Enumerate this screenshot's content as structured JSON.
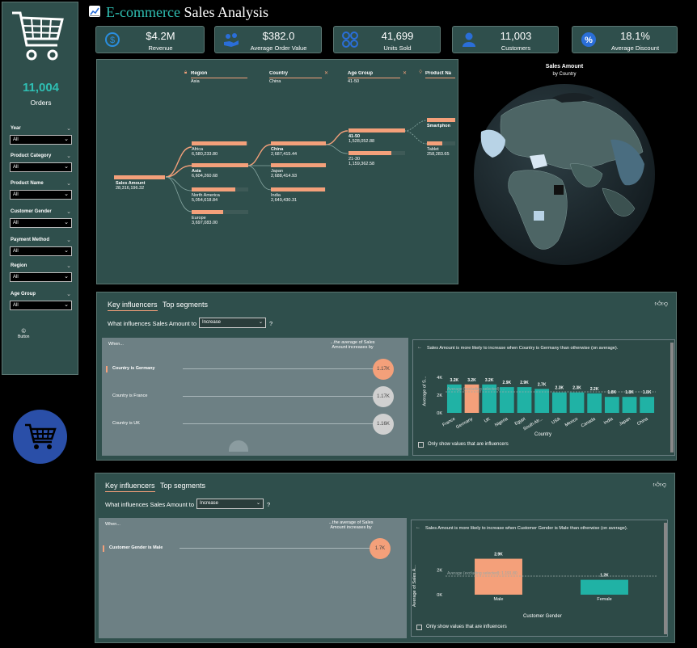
{
  "title": {
    "icon": "chart-increasing-icon",
    "prefix": "E-commerce",
    "rest": "Sales Analysis"
  },
  "sidebar": {
    "orders_value": "11,004",
    "orders_label": "Orders",
    "filters": [
      {
        "label": "Year",
        "value": "All"
      },
      {
        "label": "Product Category",
        "value": "All"
      },
      {
        "label": "Product Name",
        "value": "All"
      },
      {
        "label": "Customer Gender",
        "value": "All"
      },
      {
        "label": "Payment Method",
        "value": "All"
      },
      {
        "label": "Region",
        "value": "All"
      },
      {
        "label": "Age Group",
        "value": "All"
      }
    ],
    "button_label": "Button"
  },
  "kpis": [
    {
      "value": "$4.2M",
      "label": "Revenue",
      "icon": "dollar-icon"
    },
    {
      "value": "$382.0",
      "label": "Average Order Value",
      "icon": "hand-money-icon"
    },
    {
      "value": "41,699",
      "label": "Units Sold",
      "icon": "boxes-icon"
    },
    {
      "value": "11,003",
      "label": "Customers",
      "icon": "person-icon"
    },
    {
      "value": "18.1%",
      "label": "Average Discount",
      "icon": "percent-icon"
    }
  ],
  "decomp": {
    "headers": [
      {
        "title": "Region",
        "sub": "Asia",
        "icon": "lock-icon"
      },
      {
        "title": "Country",
        "sub": "China",
        "icon": "close-icon"
      },
      {
        "title": "Age Group",
        "sub": "41-50",
        "icon": "close-icon"
      },
      {
        "title": "Product Na",
        "sub": "",
        "icon": "bulb-icon"
      }
    ],
    "root": {
      "name": "Sales Amount",
      "value": "28,316,196.32"
    },
    "regions": [
      {
        "name": "Africa",
        "value": "6,580,233.80",
        "fill": 0.97
      },
      {
        "name": "Asia",
        "value": "6,604,260.68",
        "fill": 1.0
      },
      {
        "name": "North America",
        "value": "5,054,618.84",
        "fill": 0.77
      },
      {
        "name": "Europe",
        "value": "3,697,083.00",
        "fill": 0.56
      }
    ],
    "countries": [
      {
        "name": "China",
        "value": "2,687,415.44",
        "fill": 1.0
      },
      {
        "name": "Japan",
        "value": "2,688,414.93",
        "fill": 1.0
      },
      {
        "name": "India",
        "value": "2,649,430.31",
        "fill": 0.99
      }
    ],
    "ages": [
      {
        "name": "41-50",
        "value": "1,528,052.88",
        "fill": 1.0
      },
      {
        "name": "21-30",
        "value": "1,159,362.58",
        "fill": 0.76
      }
    ],
    "products": [
      {
        "name": "Smartphon",
        "value": "",
        "fill": 1.0
      },
      {
        "name": "Tablet",
        "value": "258,283.65",
        "fill": 0.55
      }
    ]
  },
  "map": {
    "title": "Sales Amount",
    "subtitle": "by Country"
  },
  "ki1": {
    "tab1": "Key influencers",
    "tab2": "Top segments",
    "question": "What influences Sales Amount to",
    "dropdown": "Increase",
    "q_mark": "?",
    "when": "When...",
    "avg_header": "...the average of Sales Amount increases by",
    "rows": [
      {
        "label": "Country is Germany",
        "value": "1.17K",
        "highlight": true
      },
      {
        "label": "Country is France",
        "value": "1.17K",
        "highlight": false
      },
      {
        "label": "Country is UK",
        "value": "1.16K",
        "highlight": false
      }
    ],
    "right_title": "Sales Amount is more likely to increase when Country is Germany than otherwise (on average).",
    "ylabel": "Average of S...",
    "xlabel": "Country",
    "checkbox": "Only show values that are influencers",
    "avg_line": "Average (excluding selected): ...",
    "chart_data": {
      "type": "bar",
      "ylim": [
        0,
        4000
      ],
      "yticks": [
        "4K",
        "2K",
        "0K"
      ],
      "categories": [
        "France",
        "Germany",
        "UK",
        "Nigeria",
        "Egypt",
        "South Afr...",
        "USA",
        "Mexico",
        "Canada",
        "India",
        "Japan",
        "China"
      ],
      "values": [
        3200,
        3200,
        3200,
        2900,
        2900,
        2700,
        2300,
        2300,
        2200,
        1800,
        1800,
        1800
      ],
      "labels": [
        "3.2K",
        "3.2K",
        "3.2K",
        "2.9K",
        "2.9K",
        "2.7K",
        "2.3K",
        "2.3K",
        "2.2K",
        "1.8K",
        "1.8K",
        "1.8K"
      ],
      "highlight": "Germany"
    }
  },
  "ki2": {
    "tab1": "Key influencers",
    "tab2": "Top segments",
    "question": "What influences Sales Amount to",
    "dropdown": "Increase",
    "q_mark": "?",
    "when": "When...",
    "avg_header": "...the average of Sales Amount increases by",
    "rows": [
      {
        "label": "Customer Gender is Male",
        "value": "1.7K",
        "highlight": true
      }
    ],
    "right_title": "Sales Amount is more likely to increase when Customer Gender is Male than otherwise (on average).",
    "ylabel": "Average of Sales A...",
    "xlabel": "Customer Gender",
    "checkbox": "Only show values that are influencers",
    "avg_line": "Average (excluding selected): 1,191.80",
    "chart_data": {
      "type": "bar",
      "ylim": [
        0,
        3000
      ],
      "yticks": [
        "2K",
        "0K"
      ],
      "categories": [
        "Male",
        "Female"
      ],
      "values": [
        2900,
        1200
      ],
      "labels": [
        "2.9K",
        "1.2K"
      ],
      "highlight": "Male"
    }
  }
}
